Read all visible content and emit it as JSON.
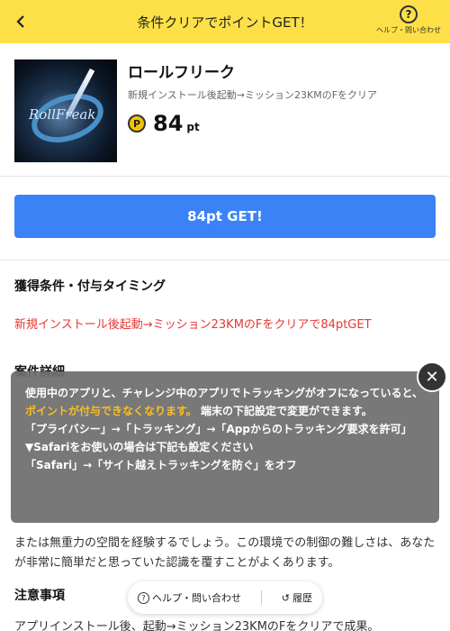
{
  "header": {
    "title": "条件クリアでポイントGET！",
    "help_label": "ヘルプ・問い合わせ",
    "help_glyph": "?",
    "back_glyph": "<"
  },
  "app": {
    "name": "ロールフリーク",
    "description": "新規インストール後起動→ミッション23KMのFをクリア",
    "thumbnail_text": "RollFreak",
    "point_icon": "P",
    "points": "84",
    "unit": "pt"
  },
  "cta": {
    "label": "84pt GET!"
  },
  "conditions": {
    "title": "獲得条件・付与タイミング",
    "text": "新規インストール後起動→ミッション23KMのFをクリアで84ptGET"
  },
  "details": {
    "title": "案件詳細",
    "text": "または無重力の空間を経験するでしょう。この環境での制御の難しさは、あなたが非常に簡単だと思っていた認識を覆すことがよくあります。"
  },
  "notes": {
    "title": "注意事項",
    "text": "アプリインストール後、起動→ミッション23KMのFをクリアで成果。"
  },
  "overlay": {
    "line1": "使用中のアプリと、チャレンジ中のアプリでトラッキングがオフになっていると、",
    "highlight": "ポイントが付与できなくなります。",
    "line2": "端末の下記設定で変更ができます。",
    "line3": "「プライバシー」→「トラッキング」→「Appからのトラッキング要求を許可」",
    "line4": "▼Safariをお使いの場合は下記も設定ください",
    "line5": "「Safari」→「サイト越えトラッキングを防ぐ」をオフ",
    "close_glyph": "✕"
  },
  "bottom_bar": {
    "help_label": "ヘルプ・問い合わせ",
    "history_label": "履歴",
    "help_glyph": "?",
    "history_glyph": "↺"
  },
  "colors": {
    "header_bg": "#fde047",
    "cta_bg": "#3b82f6",
    "condition_text": "#e53935",
    "highlight": "#fbbf24"
  }
}
